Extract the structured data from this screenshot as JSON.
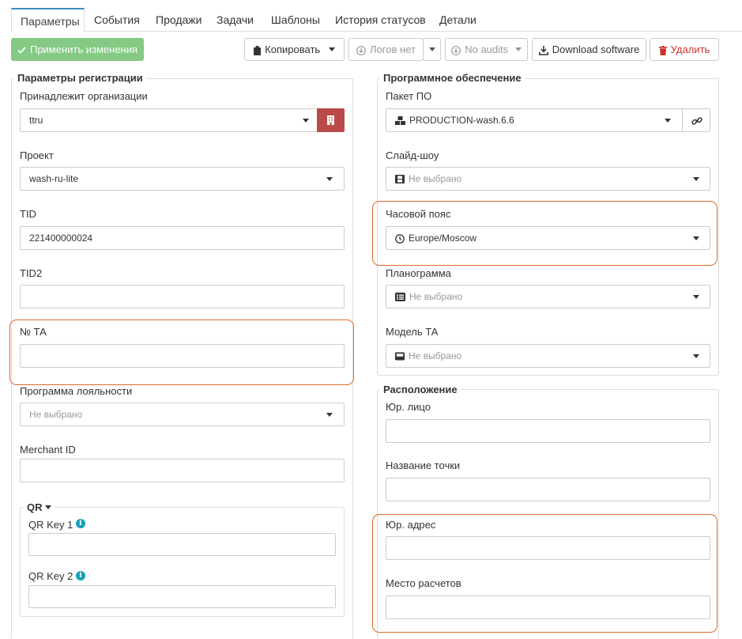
{
  "tabs": [
    "Параметры",
    "События",
    "Продажи",
    "Задачи",
    "Шаблоны",
    "История статусов",
    "Детали"
  ],
  "toolbar": {
    "apply": "Применить изменения",
    "copy": "Копировать",
    "logs": "Логов нет",
    "audits": "No audits",
    "download": "Download software",
    "delete": "Удалить"
  },
  "reg": {
    "legend": "Параметры регистрации",
    "org_label": "Принадлежит организации",
    "org_value": "ttru",
    "project_label": "Проект",
    "project_value": "wash-ru-lite",
    "tid_label": "TID",
    "tid_value": "221400000024",
    "tid2_label": "TID2",
    "tid2_value": "",
    "ta_label": "№ ТА",
    "ta_value": "",
    "loyalty_label": "Программа лояльности",
    "loyalty_value": "Не выбрано",
    "merchant_label": "Merchant ID",
    "merchant_value": ""
  },
  "qr": {
    "legend": "QR",
    "key1_label": "QR Key 1",
    "key1_value": "",
    "key2_label": "QR Key 2",
    "key2_value": ""
  },
  "software": {
    "legend": "Программное обеспечение",
    "package_label": "Пакет ПО",
    "package_value": "PRODUCTION-wash.6.6",
    "slideshow_label": "Слайд-шоу",
    "slideshow_value": "Не выбрано",
    "tz_label": "Часовой пояс",
    "tz_value": "Europe/Moscow",
    "planogram_label": "Планограмма",
    "planogram_value": "Не выбрано",
    "model_label": "Модель ТА",
    "model_value": "Не выбрано"
  },
  "location": {
    "legend": "Расположение",
    "entity_label": "Юр. лицо",
    "entity_value": "",
    "point_label": "Название точки",
    "point_value": "",
    "address_label": "Юр. адрес",
    "address_value": "",
    "settlement_label": "Место расчетов",
    "settlement_value": ""
  },
  "colors": {
    "tab_accent": "#3c8dbc",
    "apply_button": "#5cb85c",
    "org_button": "#b94a48",
    "highlight": "#e06a2a",
    "info_icon": "#17a2b8"
  }
}
